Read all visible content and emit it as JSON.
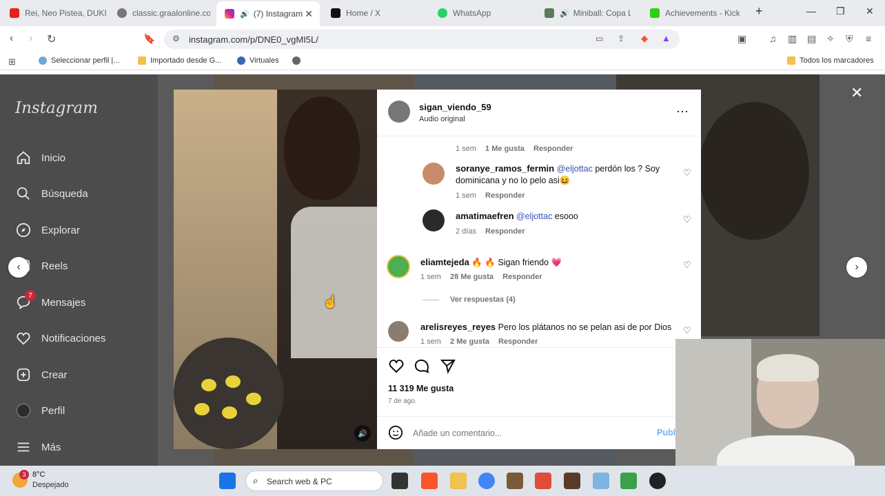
{
  "browser": {
    "tabs": [
      {
        "title": "Rei, Neo Pistea, DUKI"
      },
      {
        "title": "classic.graalonline.com"
      },
      {
        "title": "(7) Instagram"
      },
      {
        "title": "Home / X"
      },
      {
        "title": "WhatsApp"
      },
      {
        "title": "Miniball: Copa Lit"
      },
      {
        "title": "Achievements - Kick"
      }
    ],
    "url": "instagram.com/p/DNE0_vgMI5L/",
    "bookmarks": [
      "Seleccionar perfil |...",
      "Importado desde G...",
      "Virtuales"
    ],
    "bookmarks_right": "Todos los marcadores"
  },
  "instagram": {
    "logo": "Instagram",
    "nav": [
      "Inicio",
      "Búsqueda",
      "Explorar",
      "Reels",
      "Mensajes",
      "Notificaciones",
      "Crear",
      "Perfil",
      "Más"
    ],
    "messages_badge": "7"
  },
  "post": {
    "username": "sigan_viendo_59",
    "audio": "Audio original",
    "partial_top_meta": {
      "time": "1 sem",
      "likes": "1 Me gusta",
      "reply": "Responder"
    },
    "comments": [
      {
        "user": "soranye_ramos_fermin",
        "mention": "@eljottac",
        "text": " perdón los ? Soy dominicana y no lo pelo asi😆",
        "time": "1 sem",
        "likes": "",
        "reply": "Responder"
      },
      {
        "user": "amatimaefren",
        "mention": "@eljottac",
        "text": " esooo",
        "time": "2 días",
        "likes": "",
        "reply": "Responder"
      },
      {
        "user": "eliamtejeda",
        "mention": "",
        "text": "🔥 🔥 Sigan friendo 💗",
        "time": "1 sem",
        "likes": "28 Me gusta",
        "reply": "Responder"
      },
      {
        "user": "arelisreyes_reyes",
        "mention": "",
        "text": "Pero los plátanos no se pelan asi de por Dios",
        "time": "1 sem",
        "likes": "2 Me gusta",
        "reply": "Responder"
      }
    ],
    "view_replies": "Ver respuestas (4)",
    "likes_count": "11 319 Me gusta",
    "date": "7 de ago.",
    "add_comment_placeholder": "Añade un comentario...",
    "publish": "Publicar"
  },
  "taskbar": {
    "weather_temp": "8°C",
    "weather_desc": "Despejado",
    "weather_badge": "3",
    "search_placeholder": "Search web & PC"
  },
  "colors": {
    "instagram_blue": "#3852b4",
    "badge_red": "#c62a3a"
  }
}
